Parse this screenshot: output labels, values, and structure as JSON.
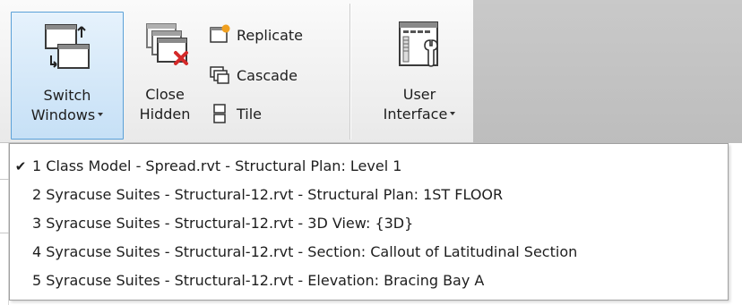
{
  "ribbon": {
    "switch_windows": {
      "line1": "Switch",
      "line2": "Windows"
    },
    "close_hidden": {
      "line1": "Close",
      "line2": "Hidden"
    },
    "replicate": "Replicate",
    "cascade": "Cascade",
    "tile": "Tile",
    "user_interface": {
      "line1": "User",
      "line2": "Interface"
    }
  },
  "window_menu": {
    "items": [
      {
        "label": "1 Class Model - Spread.rvt - Structural Plan: Level 1",
        "checked": true
      },
      {
        "label": "2 Syracuse Suites - Structural-12.rvt - Structural Plan: 1ST FLOOR",
        "checked": false
      },
      {
        "label": "3 Syracuse Suites - Structural-12.rvt - 3D View: {3D}",
        "checked": false
      },
      {
        "label": "4 Syracuse Suites - Structural-12.rvt - Section: Callout of Latitudinal Section",
        "checked": false
      },
      {
        "label": "5 Syracuse Suites - Structural-12.rvt - Elevation: Bracing Bay A",
        "checked": false
      }
    ],
    "check_glyph": "✔"
  },
  "colors": {
    "active_border": "#5ba1d8",
    "active_fill": "#c6e0f6",
    "close_red": "#d42a2a",
    "replicate_orange": "#f0a020"
  }
}
